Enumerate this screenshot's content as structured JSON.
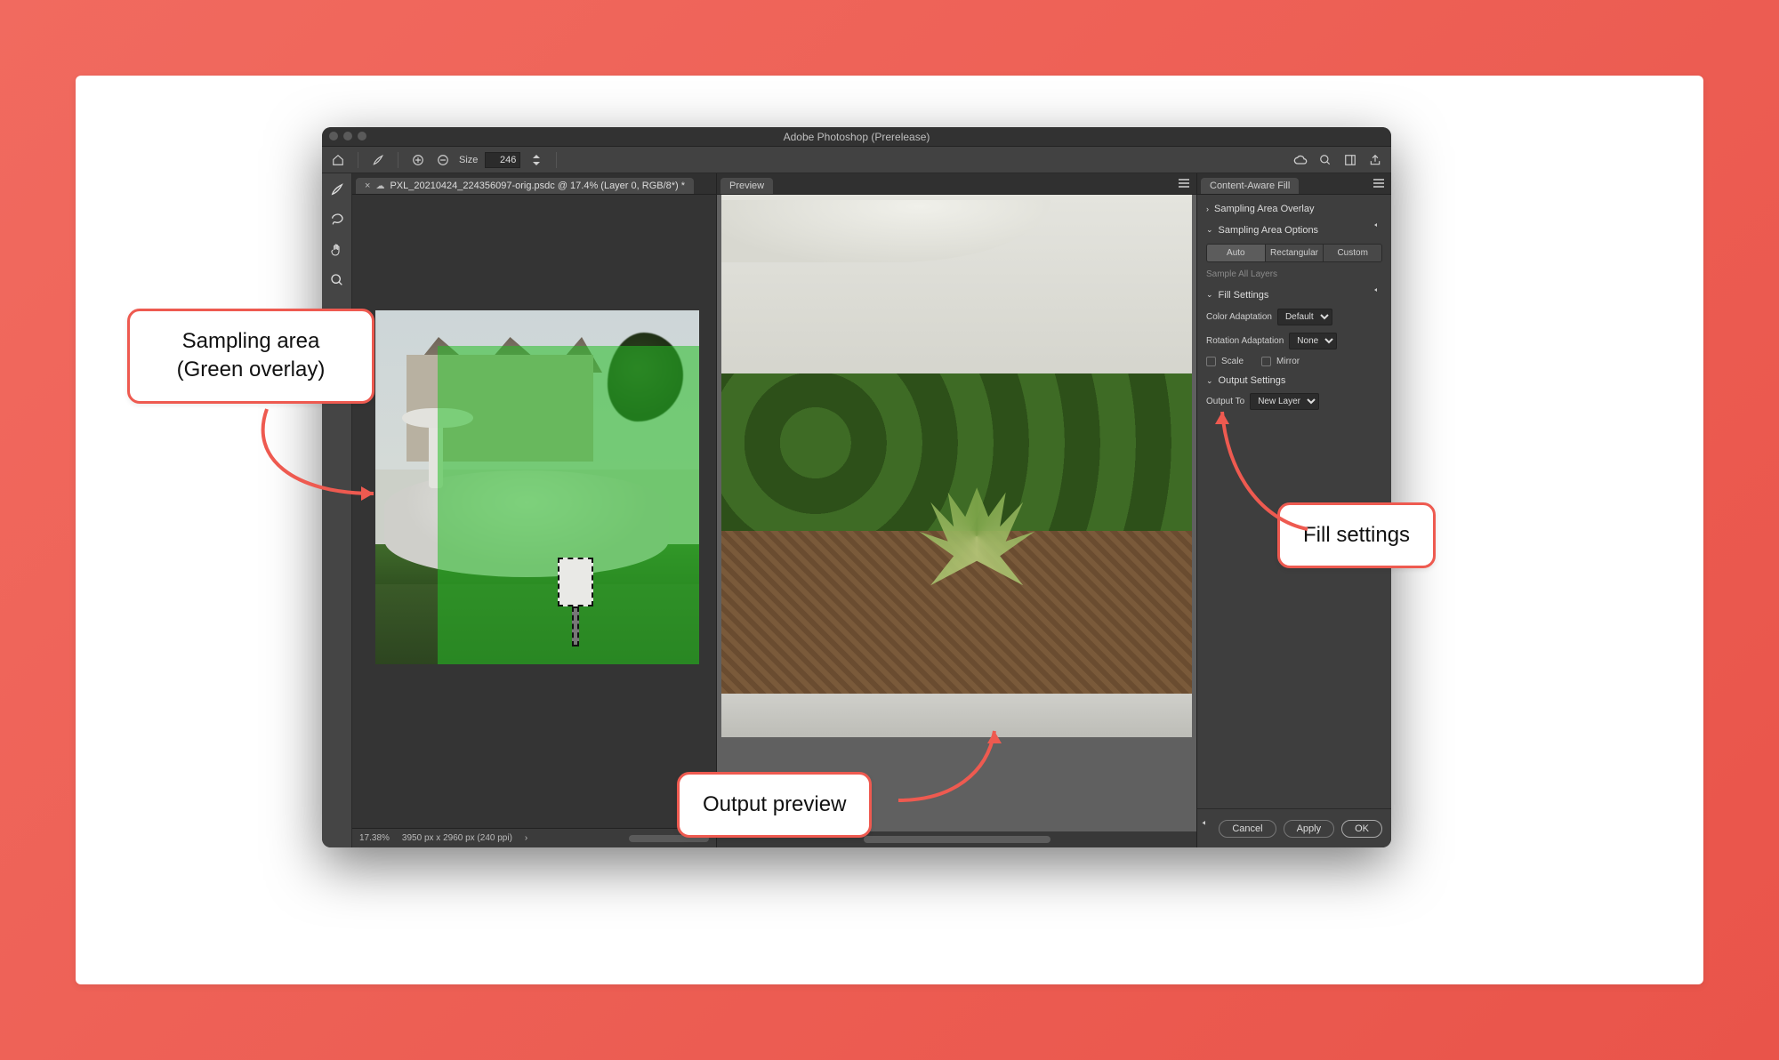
{
  "window": {
    "title": "Adobe Photoshop (Prerelease)"
  },
  "toolbar": {
    "size_label": "Size",
    "size_value": "246"
  },
  "tab": {
    "close": "×",
    "cloud_glyph": "☁",
    "filename": "PXL_20210424_224356097-orig.psdc @ 17.4% (Layer 0, RGB/8*) *"
  },
  "status": {
    "zoom": "17.38%",
    "dimensions": "3950 px x 2960 px (240 ppi)",
    "chevron": "›"
  },
  "preview": {
    "tab_label": "Preview"
  },
  "props": {
    "panel_title": "Content-Aware Fill",
    "sampling_overlay": "Sampling Area Overlay",
    "sampling_options": "Sampling Area Options",
    "mode_auto": "Auto",
    "mode_rect": "Rectangular",
    "mode_custom": "Custom",
    "sample_all_layers": "Sample All Layers",
    "fill_settings": "Fill Settings",
    "color_adaptation_label": "Color Adaptation",
    "color_adaptation_value": "Default",
    "rotation_adaptation_label": "Rotation Adaptation",
    "rotation_adaptation_value": "None",
    "scale": "Scale",
    "mirror": "Mirror",
    "output_settings": "Output Settings",
    "output_to_label": "Output To",
    "output_to_value": "New Layer",
    "cancel": "Cancel",
    "apply": "Apply",
    "ok": "OK"
  },
  "callouts": {
    "sampling_line1": "Sampling area",
    "sampling_line2": "(Green overlay)",
    "output_preview": "Output preview",
    "fill_settings": "Fill settings"
  }
}
